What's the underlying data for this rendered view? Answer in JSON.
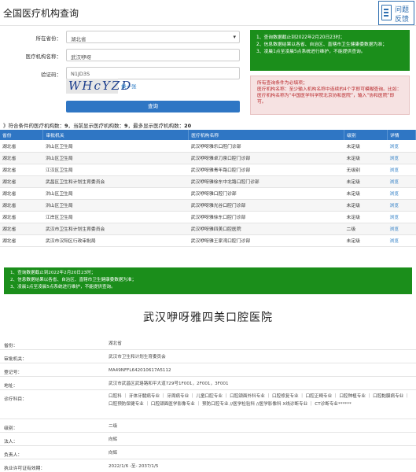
{
  "header": {
    "title": "全国医疗机构查询",
    "feedback_line1": "问题",
    "feedback_line2": "反馈"
  },
  "form": {
    "region_label": "所在省份：",
    "region_value": "湖北省",
    "name_label": "医疗机构名称：",
    "name_value": "武汉咿呀",
    "code_label": "验证码：",
    "code_value": "N1JD3S",
    "captcha_text": "WHcYZD",
    "refresh_label": "换一张",
    "query_button": "查询"
  },
  "notice_top": [
    "1、查询数据截止到2022年2月20日23时；",
    "2、信息数据结果以各省、自治区、直辖市卫生健康委数据为准；",
    "3、凌晨1点至凌晨5点系统进行维护，不能提供查询。"
  ],
  "notice_tips": [
    "所有查询条件为必填项；",
    "医疗机构名称：至少输入机构名称中连续的4个字即可模糊查询。比如：医疗机构名称为“中国医学科学院北京协和医院”，输入“协和医院”即可。"
  ],
  "stats": {
    "prefix": "》符合条件的医疗机构数：",
    "total": "9",
    "shown_label": "，当前显示医疗机构数：",
    "shown": "9",
    "max_label": "，最多显示医疗机构数：",
    "max": "20"
  },
  "table": {
    "headers": [
      "省份",
      "审批机关",
      "医疗机构名称",
      "级别",
      "详情"
    ],
    "rows": [
      [
        "湖北省",
        "洪山区卫生局",
        "武汉咿呀雅乐口腔门诊部",
        "未定级",
        "浏览"
      ],
      [
        "湖北省",
        "洪山区卫生局",
        "武汉咿呀雅卓刀泉口腔门诊部",
        "未定级",
        "浏览"
      ],
      [
        "湖北省",
        "江汉区卫生局",
        "武汉咿呀雅青年路口腔门诊部",
        "无级别",
        "浏览"
      ],
      [
        "湖北省",
        "武昌区卫生和计划生育委员会",
        "武汉咿呀雅徐东中北路口腔门诊部",
        "未定级",
        "浏览"
      ],
      [
        "湖北省",
        "洪山区卫生局",
        "武汉咿呀雅口腔门诊部",
        "未定级",
        "浏览"
      ],
      [
        "湖北省",
        "洪山区卫生局",
        "武汉咿呀雅光谷口腔门诊部",
        "未定级",
        "浏览"
      ],
      [
        "湖北省",
        "江岸区卫生局",
        "武汉咿呀雅徐东口腔门诊部",
        "未定级",
        "浏览"
      ],
      [
        "湖北省",
        "武汉市卫生和计划生育委员会",
        "武汉咿呀雅四美口腔医院",
        "二级",
        "浏览"
      ],
      [
        "湖北省",
        "武汉市汉阳区行政审批局",
        "武汉咿呀雅王家湾口腔门诊部",
        "未定级",
        "浏览"
      ]
    ]
  },
  "notice_bottom": [
    "1、查询数据截止到2022年2月20日23时；",
    "2、信息数据结果以各省、自治区、直辖市卫生健康委数据为准；",
    "3、凌晨1点至凌晨5点系统进行维护，不能提供查询。"
  ],
  "hospital": {
    "name": "武汉咿呀雅四美口腔医院",
    "fields": [
      {
        "k": "省份：",
        "v": "湖北省"
      },
      {
        "k": "审批机关：",
        "v": "武汉市卫生和计划生育委员会"
      },
      {
        "k": "登记号：",
        "v": "MA49NFFL642010617A5112"
      },
      {
        "k": "地址：",
        "v": "武汉市武昌区武珞路和平大道729号1F001，2F001，3F001"
      },
      {
        "k": "诊疗科目：",
        "v": "口腔科 ｜ 牙体牙髓病专业 ｜ 牙周病专业 ｜ 儿童口腔专业 ｜ 口腔颌面外科专业 ｜ 口腔修复专业 ｜ 口腔正畸专业 ｜ 口腔种植专业 ｜ 口腔黏膜病专业 ｜ 口腔预防保健专业 ｜ 口腔颌面医学影像专业 ｜ 预防口腔专业 //医学检验科 //医学影像科 X线诊断专业 ｜ CT诊断专业******"
      },
      {
        "k": "级别：",
        "v": "二级"
      },
      {
        "k": "法人：",
        "v": "向辉"
      },
      {
        "k": "负责人：",
        "v": "向辉"
      },
      {
        "k": "执业许可证有效期：",
        "v": "2022/1/6 -至- 2037/1/5"
      }
    ]
  }
}
